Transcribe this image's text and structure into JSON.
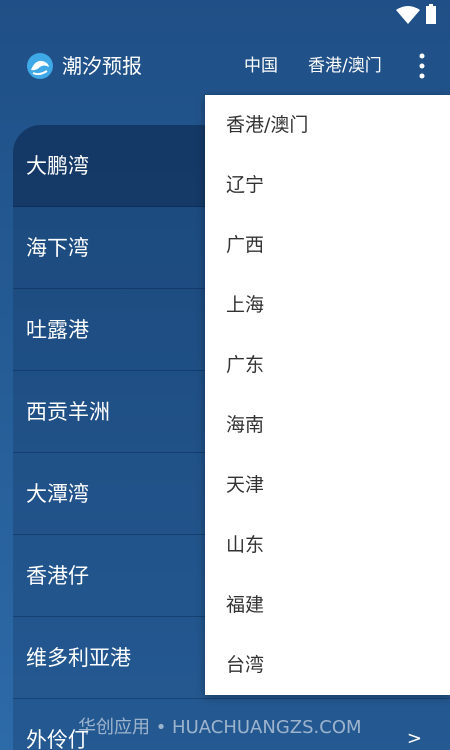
{
  "app": {
    "title": "潮汐预报",
    "nav": [
      "中国",
      "香港/澳门"
    ]
  },
  "list": {
    "items": [
      "大鹏湾",
      "海下湾",
      "吐露港",
      "西贡羊洲",
      "大潭湾",
      "香港仔",
      "维多利亚港",
      "外伶仃"
    ],
    "chevron": ">"
  },
  "dropdown": {
    "items": [
      "香港/澳门",
      "辽宁",
      "广西",
      "上海",
      "广东",
      "海南",
      "天津",
      "山东",
      "福建",
      "台湾"
    ]
  },
  "watermark": "华创应用 • HUACHUANGZS.COM",
  "colors": {
    "background_top": "#1f4f86",
    "background_bottom": "#2d6aa8",
    "menu_background": "#ffffff",
    "menu_text": "#333333"
  }
}
